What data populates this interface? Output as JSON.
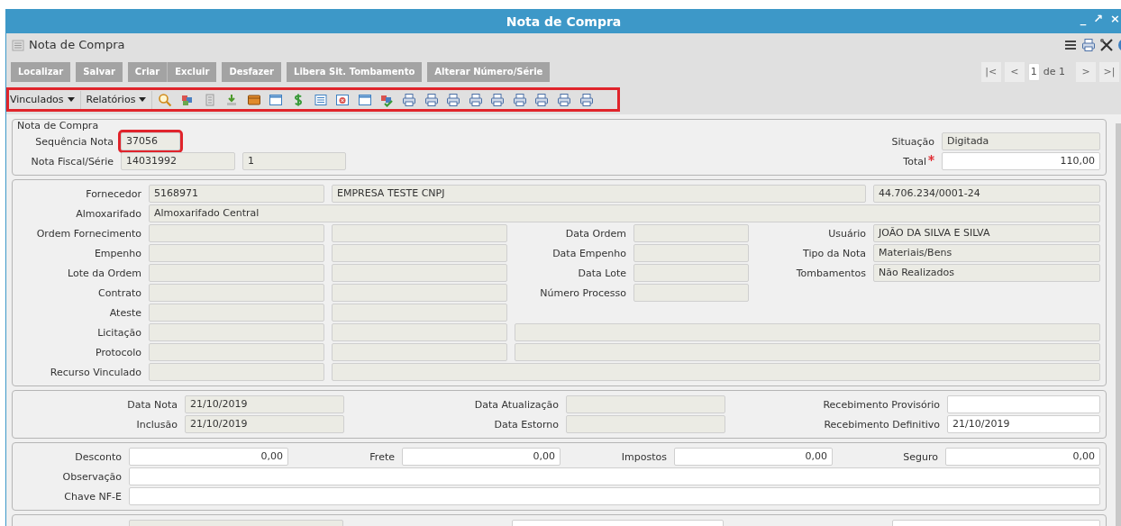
{
  "window": {
    "title": "Nota de Compra",
    "controls": [
      "_",
      "↗",
      "×"
    ]
  },
  "header": {
    "title": "Nota de Compra"
  },
  "button_groups": [
    [
      "Localizar"
    ],
    [
      "Salvar"
    ],
    [
      "Criar",
      "Excluir"
    ],
    [
      "Desfazer"
    ],
    [
      "Libera Sit. Tombamento"
    ],
    [
      "Alterar Número/Série"
    ]
  ],
  "pager": {
    "buttons_before": [
      {
        "label": "|<",
        "disabled": true
      },
      {
        "label": "<",
        "disabled": true
      }
    ],
    "page": "1",
    "of": "de 1",
    "buttons_after": [
      {
        "label": ">",
        "disabled": true
      },
      {
        "label": ">|",
        "disabled": true
      }
    ]
  },
  "toolbar": {
    "highlighted": true,
    "menus": [
      "Vinculados",
      "Relatórios"
    ]
  },
  "sections": [
    {
      "title": "Nota de Compra",
      "rows": [
        [
          {
            "label": "Sequência Nota",
            "fields": [
              {
                "value": "37056",
                "readonly": true,
                "highlighted": true
              }
            ]
          },
          {
            "label": "Situação",
            "fields": [
              {
                "value": "Digitada",
                "readonly": true,
                "highlighted": false
              }
            ]
          }
        ],
        [
          {
            "label": "Nota Fiscal/Série",
            "fields": [
              {
                "value": "14031992",
                "readonly": true,
                "highlighted": false
              },
              {
                "value": "1",
                "readonly": true,
                "highlighted": false
              }
            ]
          },
          {
            "label": "Total",
            "required": true,
            "fields": [
              {
                "value": "110,00",
                "readonly": false,
                "highlighted": false
              }
            ]
          }
        ]
      ]
    },
    {
      "rows": [
        [
          {
            "label": "Fornecedor",
            "fields": [
              {
                "value": "5168971",
                "readonly": true
              },
              {
                "value": "EMPRESA TESTE CNPJ",
                "readonly": true
              },
              {
                "value": "44.706.234/0001-24",
                "readonly": true
              }
            ]
          }
        ],
        [
          {
            "label": "Almoxarifado",
            "fields": [
              {
                "value": "Almoxarifado Central",
                "readonly": true
              }
            ]
          }
        ],
        [
          {
            "label": "Ordem Fornecimento",
            "fields": [
              {
                "readonly": true
              },
              {
                "readonly": true
              }
            ]
          },
          {
            "label": "Data Ordem",
            "fields": [
              {
                "readonly": true
              }
            ]
          },
          {
            "label": "Usuário",
            "fields": [
              {
                "value": "JOÃO DA SILVA E SILVA",
                "readonly": true
              }
            ]
          }
        ],
        [
          {
            "label": "Empenho",
            "fields": [
              {
                "readonly": true
              },
              {
                "readonly": true
              }
            ]
          },
          {
            "label": "Data Empenho",
            "fields": [
              {
                "readonly": true
              }
            ]
          },
          {
            "label": "Tipo da Nota",
            "fields": [
              {
                "value": "Materiais/Bens",
                "readonly": true
              }
            ]
          }
        ],
        [
          {
            "label": "Lote da Ordem",
            "fields": [
              {
                "readonly": true
              },
              {
                "readonly": true
              }
            ]
          },
          {
            "label": "Data Lote",
            "fields": [
              {
                "readonly": true
              }
            ]
          },
          {
            "label": "Tombamentos",
            "fields": [
              {
                "value": "Não Realizados",
                "readonly": true
              }
            ]
          }
        ],
        [
          {
            "label": "Contrato",
            "fields": [
              {
                "readonly": true
              },
              {
                "readonly": true
              }
            ]
          },
          {
            "label": "Número Processo",
            "fields": [
              {
                "readonly": true
              }
            ]
          }
        ],
        [
          {
            "label": "Ateste",
            "fields": [
              {
                "readonly": true
              },
              {
                "readonly": true
              }
            ]
          }
        ],
        [
          {
            "label": "Licitação",
            "fields": [
              {
                "readonly": true
              },
              {
                "readonly": true
              },
              {
                "readonly": true
              }
            ]
          }
        ],
        [
          {
            "label": "Protocolo",
            "fields": [
              {
                "readonly": true
              },
              {
                "readonly": true
              },
              {
                "readonly": true
              }
            ]
          }
        ],
        [
          {
            "label": "Recurso Vinculado",
            "fields": [
              {
                "readonly": true
              },
              {
                "readonly": true
              }
            ]
          }
        ]
      ]
    },
    {
      "rows": [
        [
          {
            "label": "Data Nota",
            "fields": [
              {
                "value": "21/10/2019",
                "readonly": true
              }
            ]
          },
          {
            "label": "Data Atualização",
            "fields": [
              {
                "readonly": true
              }
            ]
          },
          {
            "label": "Recebimento Provisório",
            "fields": [
              {
                "readonly": false
              }
            ]
          }
        ],
        [
          {
            "label": "Inclusão",
            "fields": [
              {
                "value": "21/10/2019",
                "readonly": true
              }
            ]
          },
          {
            "label": "Data Estorno",
            "fields": [
              {
                "readonly": true
              }
            ]
          },
          {
            "label": "Recebimento Definitivo",
            "fields": [
              {
                "value": "21/10/2019",
                "readonly": false
              }
            ]
          }
        ]
      ]
    },
    {
      "rows": [
        [
          {
            "label": "Desconto",
            "fields": [
              {
                "value": "0,00",
                "readonly": false
              }
            ]
          },
          {
            "label": "Frete",
            "fields": [
              {
                "value": "0,00",
                "readonly": false
              }
            ]
          },
          {
            "label": "Impostos",
            "fields": [
              {
                "value": "0,00",
                "readonly": false
              }
            ]
          },
          {
            "label": "Seguro",
            "fields": [
              {
                "value": "0,00",
                "readonly": false
              }
            ]
          }
        ],
        [
          {
            "label": "Observação",
            "fields": [
              {
                "readonly": false
              }
            ]
          }
        ],
        [
          {
            "label": "Chave NF-E",
            "fields": [
              {
                "readonly": false
              }
            ]
          }
        ]
      ]
    },
    {
      "rows": [
        [
          {
            "fields": [
              {
                "readonly": true
              }
            ]
          },
          {
            "fields": [
              {
                "readonly": false
              }
            ]
          },
          {
            "fields": [
              {
                "readonly": false
              }
            ]
          }
        ]
      ]
    }
  ]
}
